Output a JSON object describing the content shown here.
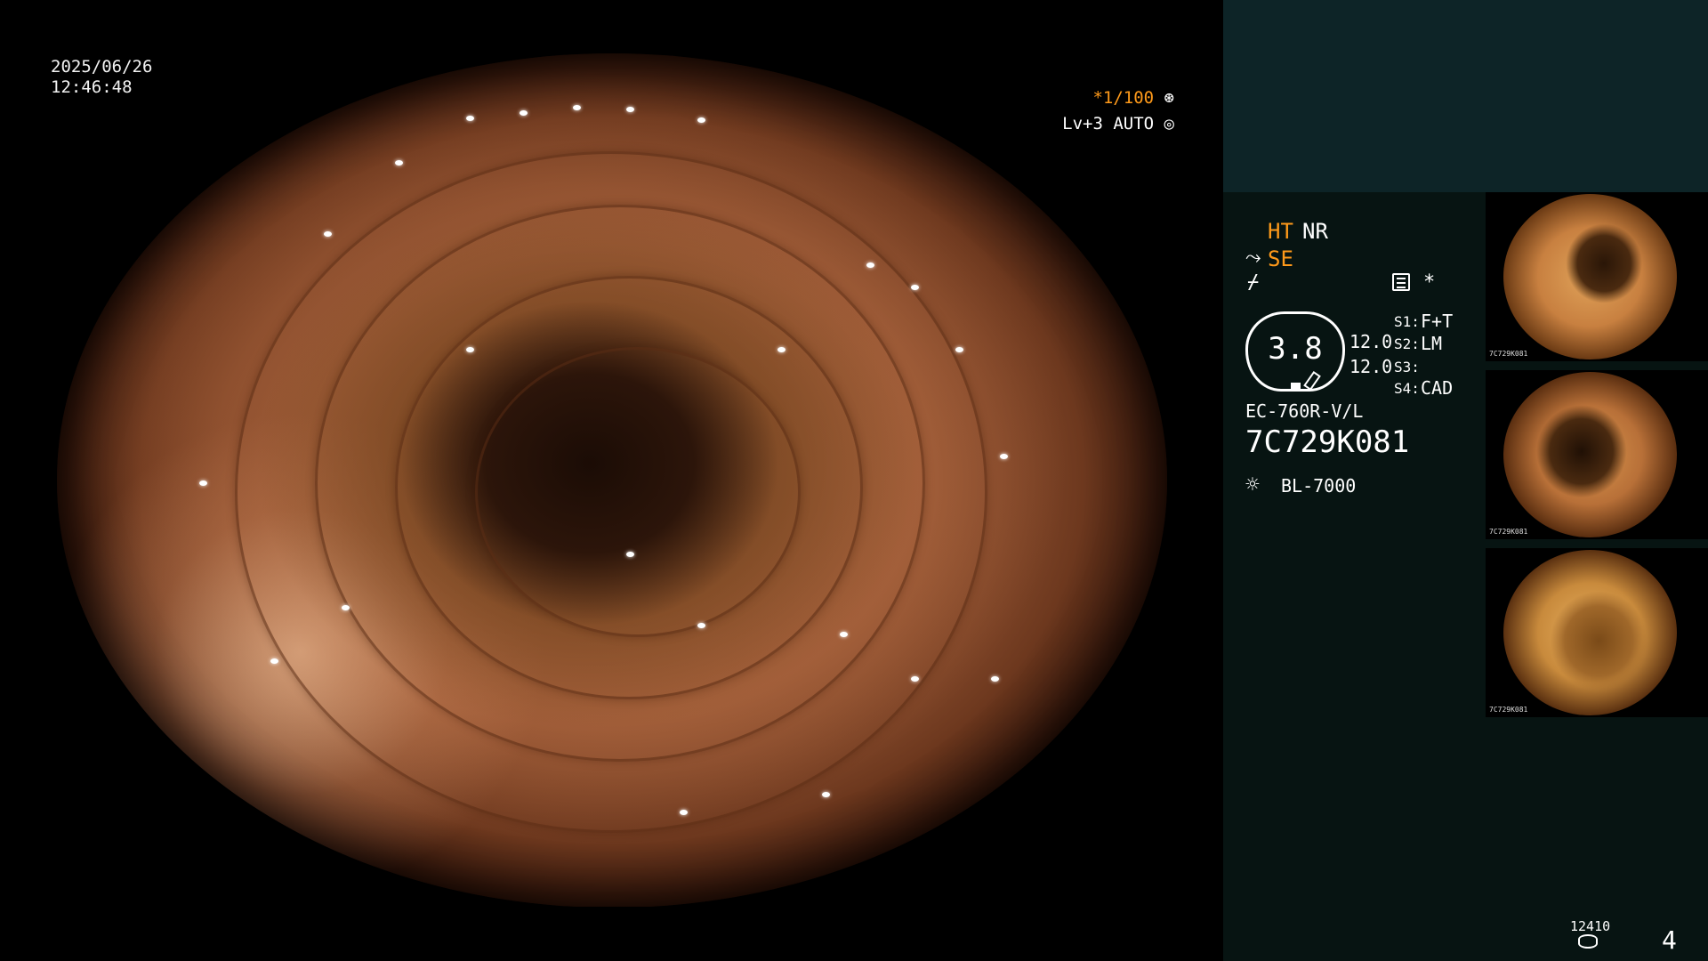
{
  "overlay": {
    "date": "2025/06/26",
    "time": "12:46:48",
    "shutter_prefix": "*",
    "shutter": "1/100",
    "shutter_icon": "aperture-icon",
    "level": "Lv+3 AUTO",
    "level_icon": "auto-iris-icon"
  },
  "panel": {
    "mode_ht": "HT",
    "mode_nr": "NR",
    "mode_se": "SE",
    "se_icon": "structure-enhancement-icon",
    "slash_icon": "signal-icon",
    "menu_icon": "menu-icon",
    "star": "*",
    "zoom": "3.8",
    "value_1": "12.0",
    "value_2": "12.0",
    "s1_label": "S1:",
    "s1_value": "F+T",
    "s2_label": "S2:",
    "s2_value": "LM",
    "s3_label": "S3:",
    "s3_value": "",
    "s4_label": "S4:",
    "s4_value": "CAD",
    "scope_model": "EC-760R-V/L",
    "scope_serial": "7C729K081",
    "light_icon": "light-source-icon",
    "light_source": "BL-7000"
  },
  "footer": {
    "record_count": "12410",
    "disk_icon": "storage-icon",
    "page": "4"
  },
  "thumbnails": [
    {
      "label": "7C729K081"
    },
    {
      "label": "7C729K081"
    },
    {
      "label": "7C729K081"
    }
  ],
  "colors": {
    "accent_orange": "#ff9a1a",
    "panel_bg": "#071412",
    "panel_teal": "#0d2427"
  }
}
